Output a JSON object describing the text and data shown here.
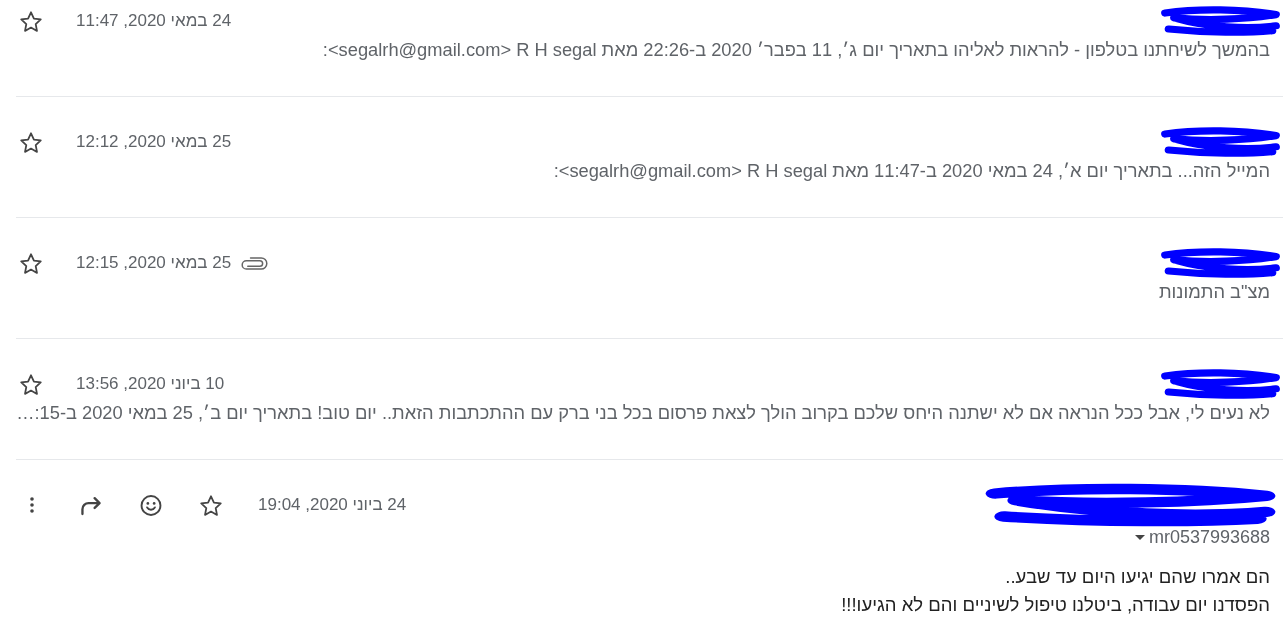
{
  "messages": [
    {
      "kind": "collapsed",
      "redacted": true,
      "starred": false,
      "has_attachment": false,
      "date": "24 במאי 2020, 11:47",
      "snippet": "בהמשך לשיחתנו בטלפון - להראות לאליהו בתאריך יום ג׳, 11 בפבר׳ 2020 ב-22:26 מאת R H segal ‏<segalrh@gmail.com>‏:"
    },
    {
      "kind": "collapsed",
      "redacted": true,
      "starred": false,
      "has_attachment": false,
      "date": "25 במאי 2020, 12:12",
      "snippet": "המייל הזה... בתאריך יום א׳, 24 במאי 2020 ב-11:47 מאת R H segal ‏<segalrh@gmail.com>‏:"
    },
    {
      "kind": "collapsed",
      "redacted": true,
      "starred": false,
      "has_attachment": true,
      "date": "25 במאי 2020, 12:15",
      "snippet": "מצ\"ב התמונות"
    },
    {
      "kind": "collapsed",
      "redacted": true,
      "starred": false,
      "has_attachment": false,
      "date": "10 ביוני 2020, 13:56",
      "snippet": "לא נעים לי, אבל ככל הנראה אם לא ישתנה היחס שלכם בקרוב הולך לצאת פרסום בכל בני ברק עם ההתכתבות הזאת.. יום טוב! בתאריך יום ב׳, 25 במאי 2020 ב-15:…"
    },
    {
      "kind": "expanded",
      "redacted": true,
      "starred": false,
      "has_attachment": false,
      "date": "24 ביוני 2020, 19:04",
      "recipient": "mr0537993688",
      "body": [
        "הם אמרו שהם יגיעו היום עד שבע..",
        "הפסדנו יום עבודה, ביטלנו טיפול לשיניים והם לא הגיעו!!!"
      ]
    }
  ]
}
